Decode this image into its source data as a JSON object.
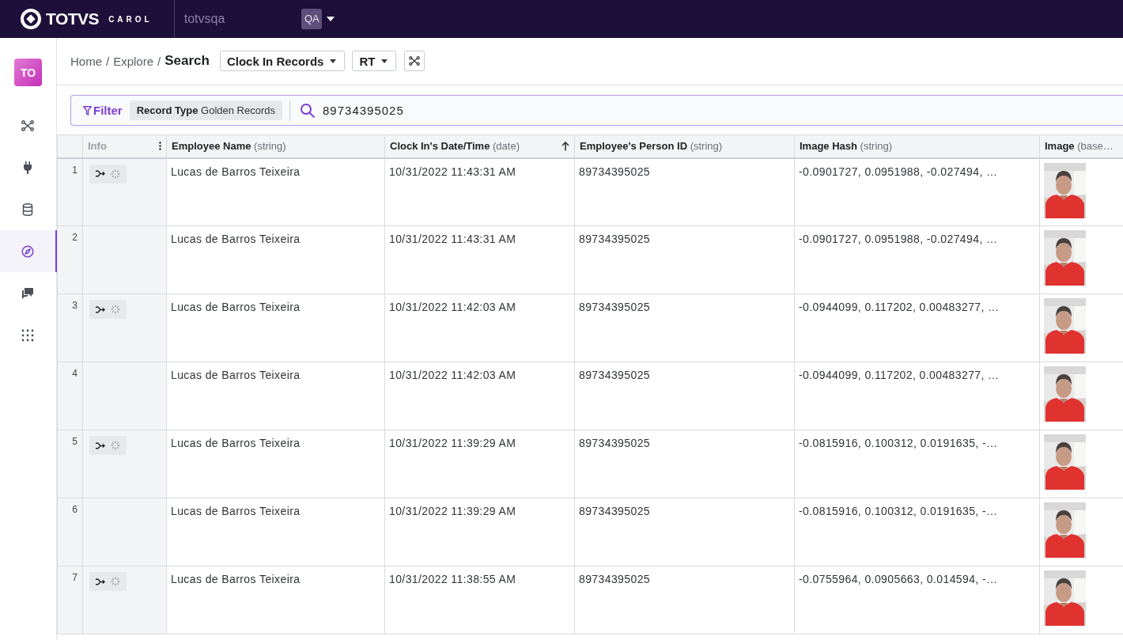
{
  "topbar": {
    "brand": "TOTVS",
    "product": "CAROL",
    "org": "totvsqa",
    "user": "QA"
  },
  "sidebar": {
    "app": "TO",
    "items": [
      {
        "kind": "network",
        "selected": false
      },
      {
        "kind": "plug",
        "selected": false
      },
      {
        "kind": "database",
        "selected": false
      },
      {
        "kind": "compass",
        "selected": true
      },
      {
        "kind": "chat",
        "selected": false
      },
      {
        "kind": "apps",
        "selected": false
      }
    ]
  },
  "breadcrumb": {
    "links": [
      "Home",
      "Explore"
    ],
    "separator": "/",
    "current": "Search"
  },
  "selectors": [
    "Clock In Records",
    "RT"
  ],
  "filter": {
    "label": "Filter",
    "chip_key": "Record Type",
    "chip_value": "Golden Records",
    "search": "89734395025"
  },
  "table": {
    "info_column": "Info",
    "columns": [
      {
        "name": "Employee Name",
        "type": "(string)",
        "sorted": false
      },
      {
        "name": "Clock In's Date/Time",
        "type": "(date)",
        "sorted": true
      },
      {
        "name": "Employee's Person ID",
        "type": "(string)",
        "sorted": false
      },
      {
        "name": "Image Hash",
        "type": "(string)",
        "sorted": false
      },
      {
        "name": "Image",
        "type": "(base…",
        "sorted": false
      }
    ],
    "rows": [
      {
        "number": "1",
        "actions": true,
        "cells": [
          "Lucas de Barros Teixeira",
          "10/31/2022 11:43:31 AM",
          "89734395025",
          "-0.0901727, 0.0951988, -0.027494, …"
        ]
      },
      {
        "number": "2",
        "actions": false,
        "cells": [
          "Lucas de Barros Teixeira",
          "10/31/2022 11:43:31 AM",
          "89734395025",
          "-0.0901727, 0.0951988, -0.027494, …"
        ]
      },
      {
        "number": "3",
        "actions": true,
        "cells": [
          "Lucas de Barros Teixeira",
          "10/31/2022 11:42:03 AM",
          "89734395025",
          "-0.0944099, 0.117202, 0.00483277, …"
        ]
      },
      {
        "number": "4",
        "actions": false,
        "cells": [
          "Lucas de Barros Teixeira",
          "10/31/2022 11:42:03 AM",
          "89734395025",
          "-0.0944099, 0.117202, 0.00483277, …"
        ]
      },
      {
        "number": "5",
        "actions": true,
        "cells": [
          "Lucas de Barros Teixeira",
          "10/31/2022 11:39:29 AM",
          "89734395025",
          "-0.0815916, 0.100312, 0.0191635, -…"
        ]
      },
      {
        "number": "6",
        "actions": false,
        "cells": [
          "Lucas de Barros Teixeira",
          "10/31/2022 11:39:29 AM",
          "89734395025",
          "-0.0815916, 0.100312, 0.0191635, -…"
        ]
      },
      {
        "number": "7",
        "actions": true,
        "cells": [
          "Lucas de Barros Teixeira",
          "10/31/2022 11:38:55 AM",
          "89734395025",
          "-0.0755964, 0.0905663, 0.014594, -…"
        ]
      }
    ]
  }
}
